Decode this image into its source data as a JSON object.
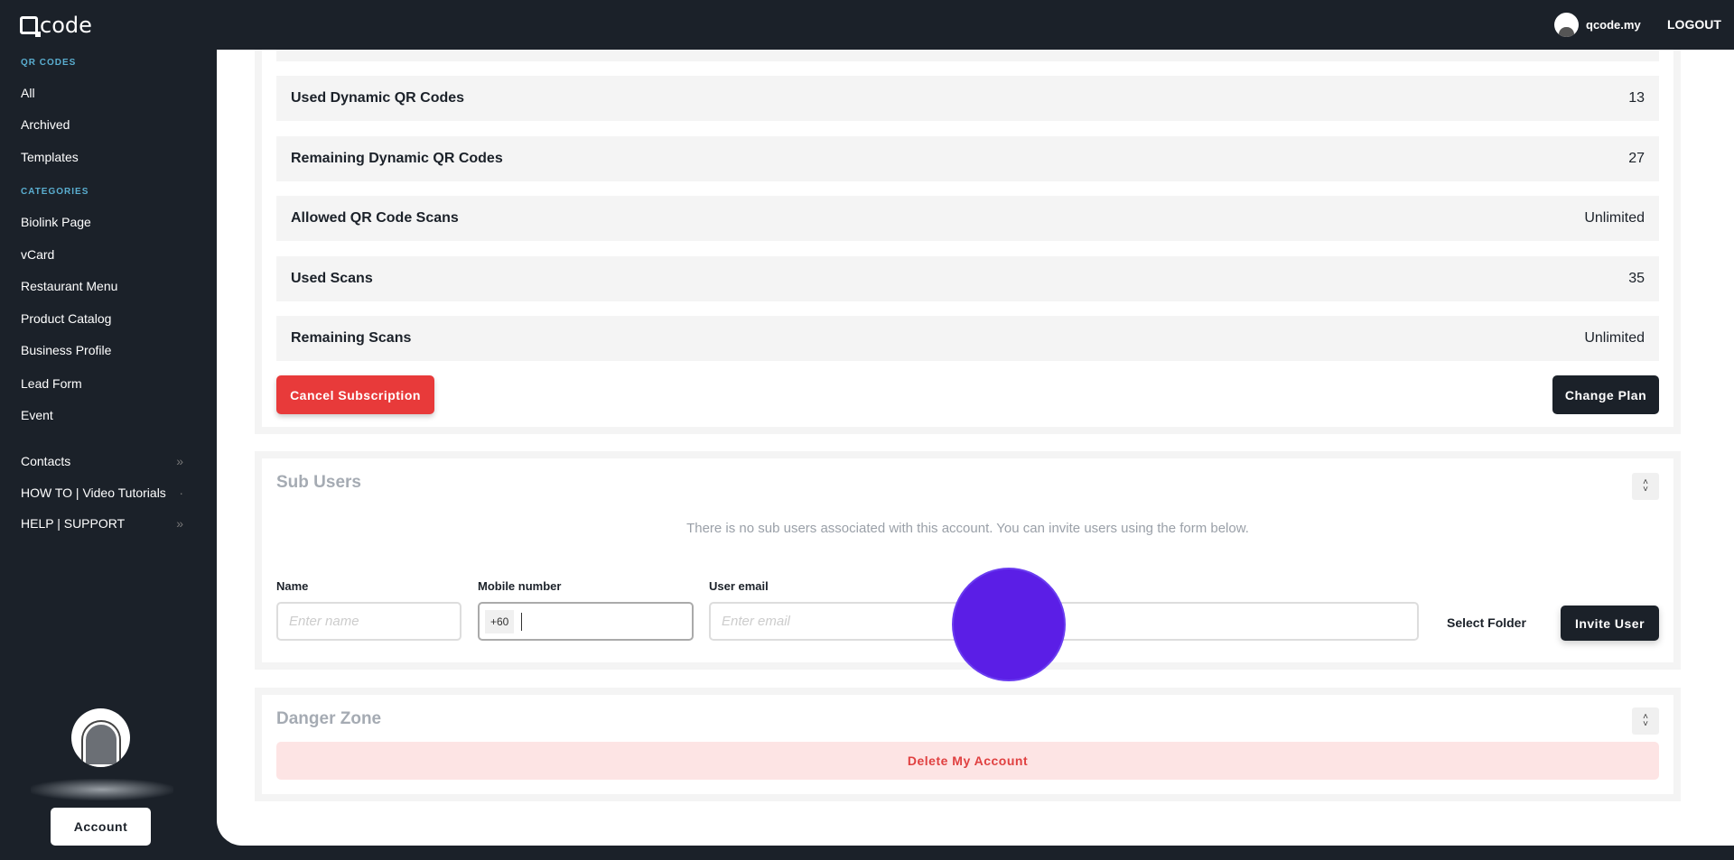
{
  "header": {
    "logo": "code",
    "username": "qcode.my",
    "logout": "LOGOUT"
  },
  "sidebar": {
    "qr_heading": "QR CODES",
    "qr_items": [
      "All",
      "Archived",
      "Templates"
    ],
    "cat_heading": "CATEGORIES",
    "cat_items": [
      "Biolink Page",
      "vCard",
      "Restaurant Menu",
      "Product Catalog",
      "Business Profile",
      "Lead Form",
      "Event"
    ],
    "extra_items": [
      "Contacts",
      "HOW TO | Video Tutorials",
      "HELP | SUPPORT"
    ],
    "account_button": "Account"
  },
  "subscription": {
    "rows": [
      {
        "label": "Used Dynamic QR Codes",
        "value": "13"
      },
      {
        "label": "Remaining Dynamic QR Codes",
        "value": "27"
      },
      {
        "label": "Allowed QR Code Scans",
        "value": "Unlimited"
      },
      {
        "label": "Used Scans",
        "value": "35"
      },
      {
        "label": "Remaining Scans",
        "value": "Unlimited"
      }
    ],
    "cancel_button": "Cancel Subscription",
    "change_button": "Change Plan"
  },
  "sub_users": {
    "title": "Sub Users",
    "empty_text": "There is no sub users associated with this account. You can invite users using the form below.",
    "name_label": "Name",
    "name_placeholder": "Enter name",
    "mobile_label": "Mobile number",
    "mobile_prefix": "+60",
    "email_label": "User email",
    "email_placeholder": "Enter email",
    "select_folder": "Select Folder",
    "invite_button": "Invite User"
  },
  "danger": {
    "title": "Danger Zone",
    "delete_button": "Delete My Account"
  },
  "colors": {
    "red": "#e83a3a",
    "dark": "#1b2129",
    "cursor": "#5b1ee6"
  }
}
